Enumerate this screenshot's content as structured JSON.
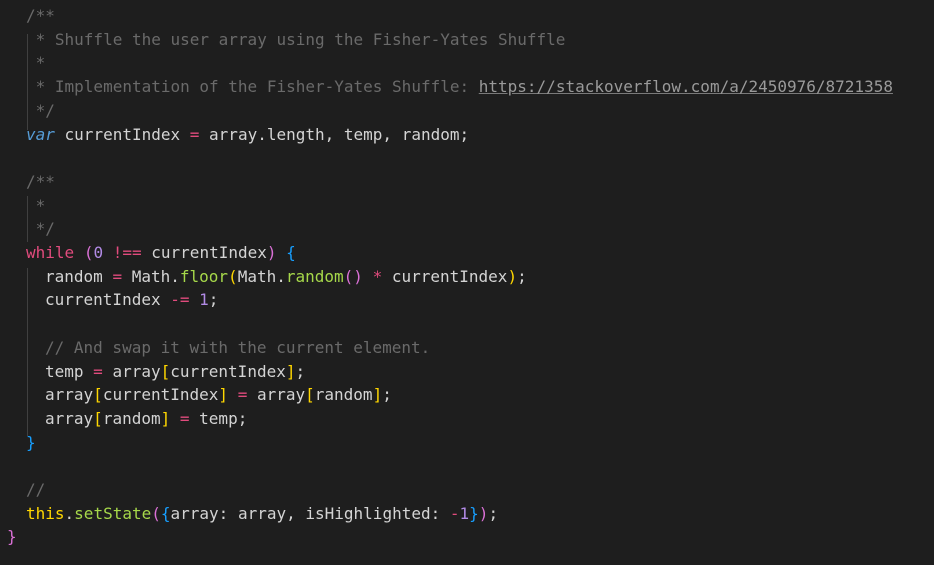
{
  "editor": {
    "lines": [
      {
        "indent": 26,
        "tokens": [
          {
            "t": "/**",
            "c": "c-comment"
          }
        ]
      },
      {
        "indent": 26,
        "tokens": [
          {
            "t": " * Shuffle the user array using the Fisher-Yates Shuffle",
            "c": "c-comment"
          }
        ]
      },
      {
        "indent": 26,
        "tokens": [
          {
            "t": " *",
            "c": "c-comment"
          }
        ]
      },
      {
        "indent": 26,
        "tokens": [
          {
            "t": " * Implementation of the Fisher-Yates Shuffle: ",
            "c": "c-comment"
          },
          {
            "t": "https://stackoverflow.com/a/2450976/8721358",
            "c": "c-link"
          }
        ]
      },
      {
        "indent": 26,
        "tokens": [
          {
            "t": " */",
            "c": "c-comment"
          }
        ]
      },
      {
        "indent": 26,
        "tokens": [
          {
            "t": "var",
            "c": "c-var"
          },
          {
            "t": " currentIndex ",
            "c": "c-ident"
          },
          {
            "t": "=",
            "c": "c-op"
          },
          {
            "t": " array.length, temp, random;",
            "c": "c-ident"
          }
        ]
      },
      {
        "indent": 26,
        "tokens": []
      },
      {
        "indent": 26,
        "tokens": [
          {
            "t": "/**",
            "c": "c-comment"
          }
        ]
      },
      {
        "indent": 26,
        "tokens": [
          {
            "t": " *",
            "c": "c-comment"
          }
        ]
      },
      {
        "indent": 26,
        "tokens": [
          {
            "t": " */",
            "c": "c-comment"
          }
        ]
      },
      {
        "indent": 26,
        "tokens": [
          {
            "t": "while",
            "c": "c-op"
          },
          {
            "t": " ",
            "c": "c-ident"
          },
          {
            "t": "(",
            "c": "c-brace"
          },
          {
            "t": "0",
            "c": "c-num"
          },
          {
            "t": " ",
            "c": "c-ident"
          },
          {
            "t": "!==",
            "c": "c-op"
          },
          {
            "t": " currentIndex",
            "c": "c-ident"
          },
          {
            "t": ")",
            "c": "c-brace"
          },
          {
            "t": " ",
            "c": "c-ident"
          },
          {
            "t": "{",
            "c": "c-brace2"
          }
        ]
      },
      {
        "indent": 45,
        "tokens": [
          {
            "t": "random ",
            "c": "c-ident"
          },
          {
            "t": "=",
            "c": "c-op"
          },
          {
            "t": " Math.",
            "c": "c-ident"
          },
          {
            "t": "floor",
            "c": "c-fn"
          },
          {
            "t": "(",
            "c": "c-paren"
          },
          {
            "t": "Math.",
            "c": "c-ident"
          },
          {
            "t": "random",
            "c": "c-fn"
          },
          {
            "t": "()",
            "c": "c-brace"
          },
          {
            "t": " ",
            "c": "c-ident"
          },
          {
            "t": "*",
            "c": "c-op"
          },
          {
            "t": " currentIndex",
            "c": "c-ident"
          },
          {
            "t": ")",
            "c": "c-paren"
          },
          {
            "t": ";",
            "c": "c-ident"
          }
        ]
      },
      {
        "indent": 45,
        "tokens": [
          {
            "t": "currentIndex ",
            "c": "c-ident"
          },
          {
            "t": "-=",
            "c": "c-op"
          },
          {
            "t": " ",
            "c": "c-ident"
          },
          {
            "t": "1",
            "c": "c-num"
          },
          {
            "t": ";",
            "c": "c-ident"
          }
        ]
      },
      {
        "indent": 45,
        "tokens": []
      },
      {
        "indent": 45,
        "tokens": [
          {
            "t": "// And swap it with the current element.",
            "c": "c-comment"
          }
        ]
      },
      {
        "indent": 45,
        "tokens": [
          {
            "t": "temp ",
            "c": "c-ident"
          },
          {
            "t": "=",
            "c": "c-op"
          },
          {
            "t": " array",
            "c": "c-ident"
          },
          {
            "t": "[",
            "c": "c-paren"
          },
          {
            "t": "currentIndex",
            "c": "c-ident"
          },
          {
            "t": "]",
            "c": "c-paren"
          },
          {
            "t": ";",
            "c": "c-ident"
          }
        ]
      },
      {
        "indent": 45,
        "tokens": [
          {
            "t": "array",
            "c": "c-ident"
          },
          {
            "t": "[",
            "c": "c-paren"
          },
          {
            "t": "currentIndex",
            "c": "c-ident"
          },
          {
            "t": "]",
            "c": "c-paren"
          },
          {
            "t": " ",
            "c": "c-ident"
          },
          {
            "t": "=",
            "c": "c-op"
          },
          {
            "t": " array",
            "c": "c-ident"
          },
          {
            "t": "[",
            "c": "c-paren"
          },
          {
            "t": "random",
            "c": "c-ident"
          },
          {
            "t": "]",
            "c": "c-paren"
          },
          {
            "t": ";",
            "c": "c-ident"
          }
        ]
      },
      {
        "indent": 45,
        "tokens": [
          {
            "t": "array",
            "c": "c-ident"
          },
          {
            "t": "[",
            "c": "c-paren"
          },
          {
            "t": "random",
            "c": "c-ident"
          },
          {
            "t": "]",
            "c": "c-paren"
          },
          {
            "t": " ",
            "c": "c-ident"
          },
          {
            "t": "=",
            "c": "c-op"
          },
          {
            "t": " temp;",
            "c": "c-ident"
          }
        ]
      },
      {
        "indent": 26,
        "tokens": [
          {
            "t": "}",
            "c": "c-brace2"
          }
        ]
      },
      {
        "indent": 26,
        "tokens": []
      },
      {
        "indent": 26,
        "tokens": [
          {
            "t": "//",
            "c": "c-comment"
          }
        ]
      },
      {
        "indent": 26,
        "tokens": [
          {
            "t": "this",
            "c": "c-this"
          },
          {
            "t": ".",
            "c": "c-ident"
          },
          {
            "t": "setState",
            "c": "c-fn"
          },
          {
            "t": "(",
            "c": "c-brace"
          },
          {
            "t": "{",
            "c": "c-brace2"
          },
          {
            "t": "array: array, isHighlighted: ",
            "c": "c-ident"
          },
          {
            "t": "-",
            "c": "c-op"
          },
          {
            "t": "1",
            "c": "c-num"
          },
          {
            "t": "}",
            "c": "c-brace2"
          },
          {
            "t": ")",
            "c": "c-brace"
          },
          {
            "t": ";",
            "c": "c-ident"
          }
        ]
      },
      {
        "indent": 7,
        "tokens": [
          {
            "t": "}",
            "c": "c-brace"
          }
        ]
      }
    ]
  }
}
